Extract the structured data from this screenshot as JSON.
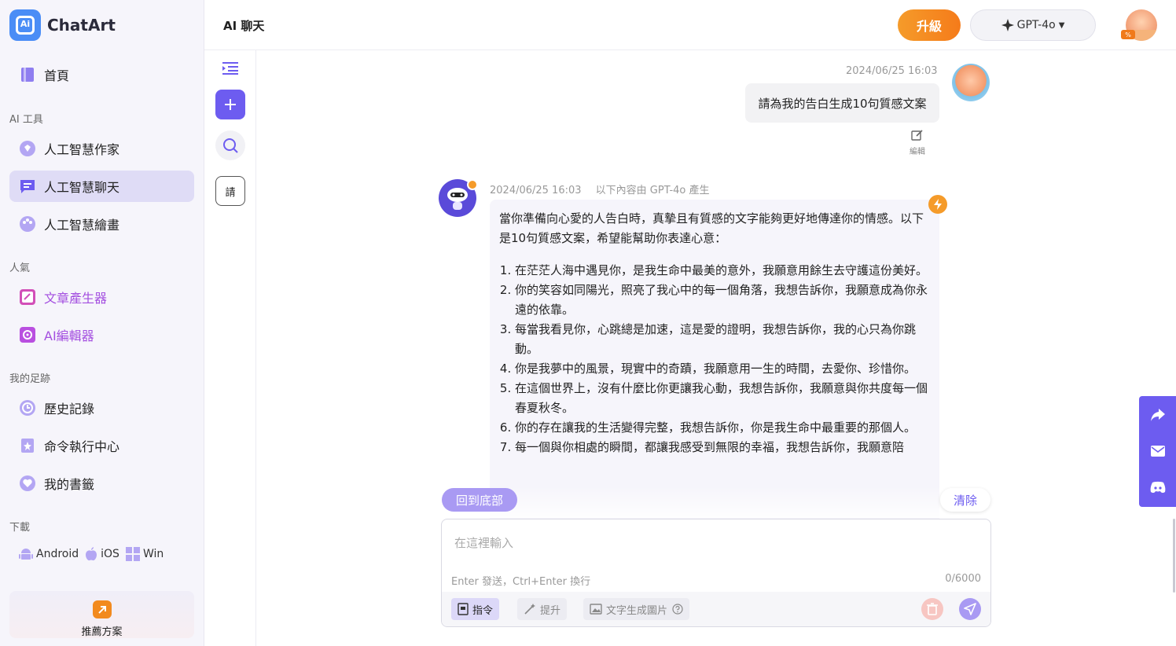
{
  "app": {
    "logo_mark": "Ai",
    "name": "ChatArt"
  },
  "sidebar": {
    "home": "首頁",
    "sections": {
      "ai_tools": "AI 工具",
      "popular": "人氣",
      "footprint": "我的足跡",
      "download": "下載"
    },
    "ai_tools": [
      "人工智慧作家",
      "人工智慧聊天",
      "人工智慧繪畫"
    ],
    "popular": [
      "文章產生器",
      "AI編輯器"
    ],
    "footprint": [
      "歷史記錄",
      "命令執行中心",
      "我的書籤"
    ],
    "downloads": [
      "Android",
      "iOS",
      "Win"
    ],
    "promo_label": "推薦方案"
  },
  "header": {
    "title": "AI 聊天",
    "upgrade": "升級",
    "model": "GPT-4o",
    "avatar_badge": "%"
  },
  "toolcol": {
    "prompt_label": "請"
  },
  "chat": {
    "user": {
      "timestamp": "2024/06/25 16:03",
      "message": "請為我的告白生成10句質感文案",
      "edit_label": "編輯"
    },
    "bot": {
      "timestamp": "2024/06/25 16:03",
      "source": "以下內容由 GPT-4o 產生",
      "intro": "當你準備向心愛的人告白時，真摯且有質感的文字能夠更好地傳達你的情感。以下是10句質感文案，希望能幫助你表達心意：",
      "items": [
        "在茫茫人海中遇見你，是我生命中最美的意外，我願意用餘生去守護這份美好。",
        "你的笑容如同陽光，照亮了我心中的每一個角落，我想告訴你，我願意成為你永遠的依靠。",
        "每當我看見你，心跳總是加速，這是愛的證明，我想告訴你，我的心只為你跳動。",
        "你是我夢中的風景，現實中的奇蹟，我願意用一生的時間，去愛你、珍惜你。",
        "在這個世界上，沒有什麼比你更讓我心動，我想告訴你，我願意與你共度每一個春夏秋冬。",
        "你的存在讓我的生活變得完整，我想告訴你，你是我生命中最重要的那個人。",
        "每一個與你相處的瞬間，都讓我感受到無限的幸福，我想告訴你，我願意陪"
      ]
    },
    "back_to_bottom": "回到底部",
    "clear": "清除"
  },
  "composer": {
    "placeholder": "在這裡輸入",
    "hint": "Enter 發送，Ctrl+Enter 換行",
    "count": "0/6000",
    "chips": {
      "prompt": "指令",
      "enhance": "提升",
      "text_to_image": "文字生成圖片"
    }
  },
  "colors": {
    "accent": "#6d5cf0",
    "upgrade": "#f57b1a",
    "active_nav": "#dfdcf6"
  }
}
